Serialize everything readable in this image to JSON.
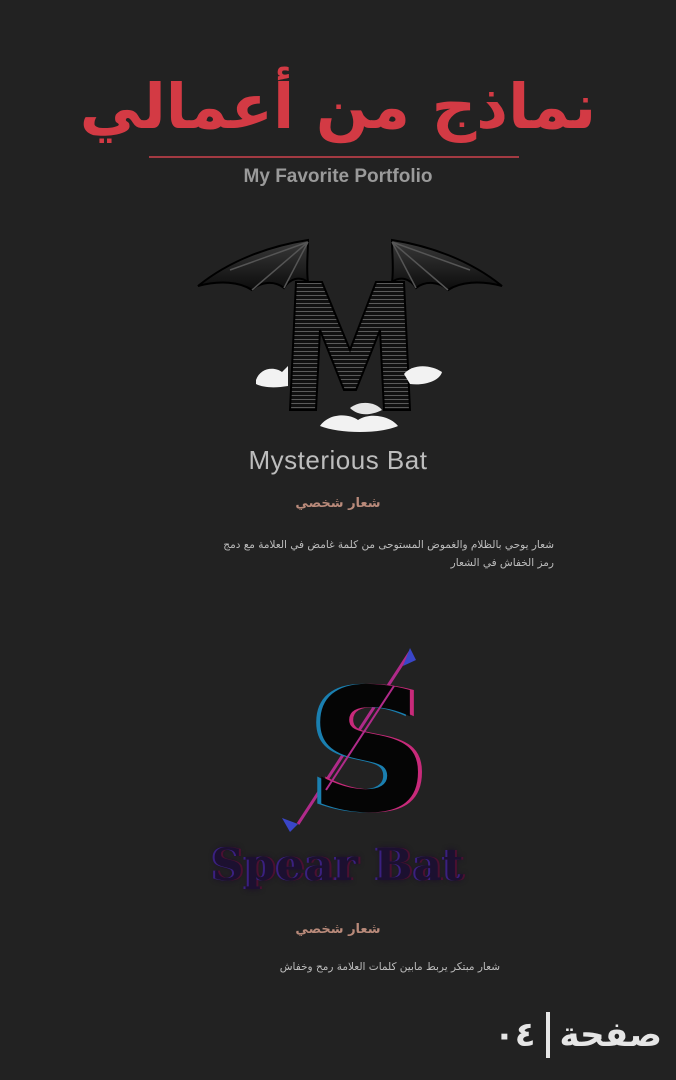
{
  "header": {
    "title": "نماذج من أعمالي",
    "subtitle": "My Favorite Portfolio"
  },
  "works": [
    {
      "name": "Mysterious Bat",
      "kind": "شعار شخصي",
      "description_line1": "شعار يوحي بالظلام والغموض المستوحى من كلمة غامض في العلامة مع دمج",
      "description_line2": "رمز الخفاش في الشعار"
    },
    {
      "name": "Spear Bat",
      "kind": "شعار شخصي",
      "description_line1": "شعار مبتكر يربط مابين كلمات العلامة رمح وخفاش"
    }
  ],
  "footer": {
    "page_label": "صفحة",
    "page_number": "٠٤"
  },
  "colors": {
    "background": "#222222",
    "title_red": "#d33a44",
    "kind_label": "#b98a7a"
  }
}
